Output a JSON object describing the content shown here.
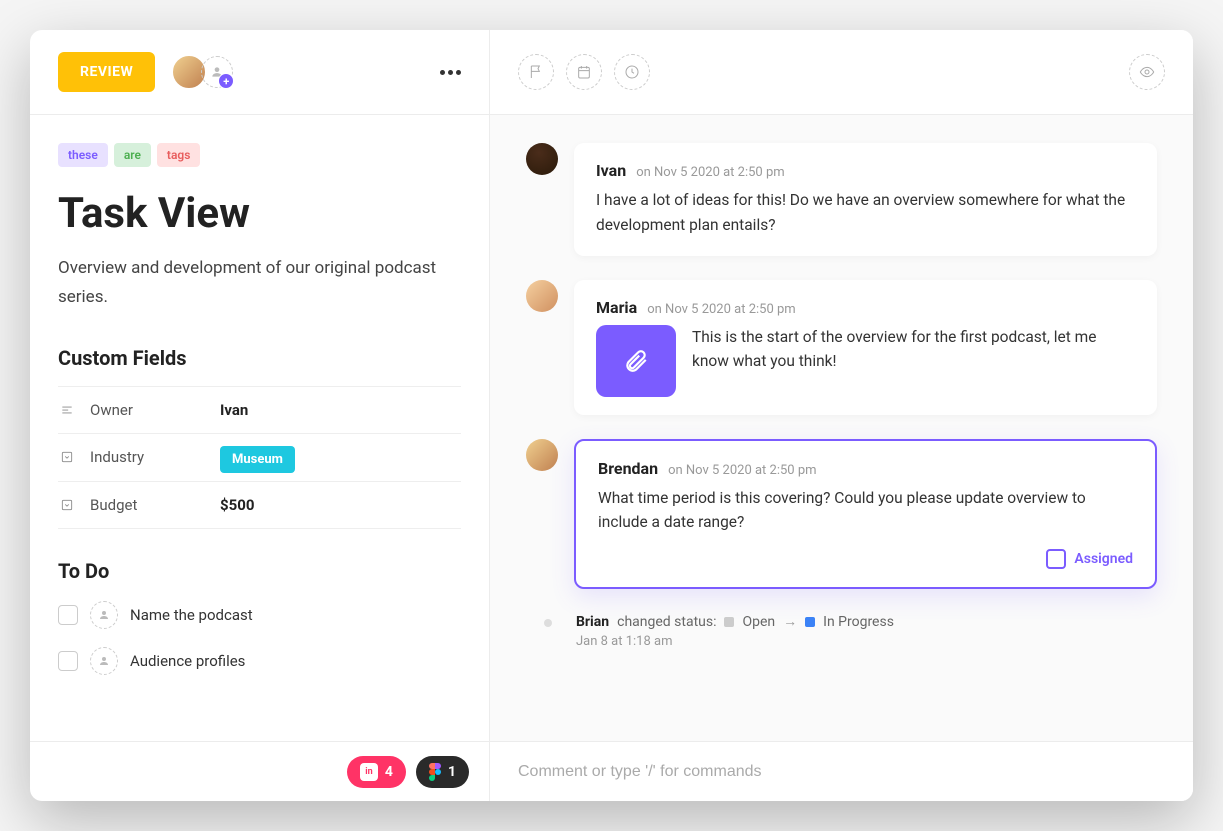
{
  "header": {
    "status_badge": "REVIEW"
  },
  "tags": [
    {
      "label": "these",
      "variant": "purple"
    },
    {
      "label": "are",
      "variant": "green"
    },
    {
      "label": "tags",
      "variant": "pink"
    }
  ],
  "page": {
    "title": "Task View",
    "description": "Overview and development of our original podcast series."
  },
  "custom_fields": {
    "section_title": "Custom Fields",
    "rows": [
      {
        "label": "Owner",
        "value": "Ivan",
        "type": "text"
      },
      {
        "label": "Industry",
        "value": "Museum",
        "type": "badge"
      },
      {
        "label": "Budget",
        "value": "$500",
        "type": "text"
      }
    ]
  },
  "todo": {
    "section_title": "To Do",
    "items": [
      {
        "text": "Name the podcast"
      },
      {
        "text": "Audience profiles"
      }
    ]
  },
  "footer_pills": {
    "invision_count": "4",
    "figma_count": "1"
  },
  "comments": [
    {
      "author": "Ivan",
      "time": "on Nov 5 2020 at 2:50 pm",
      "text": "I have a lot of ideas for this! Do we have an overview somewhere for what the development plan entails?",
      "avatar": "ivan"
    },
    {
      "author": "Maria",
      "time": "on Nov 5 2020 at 2:50 pm",
      "text": "This is the start of the overview for the first podcast, let me know what you think!",
      "avatar": "maria",
      "has_attachment": true
    },
    {
      "author": "Brendan",
      "time": "on Nov 5 2020 at 2:50 pm",
      "text": "What time period is this covering? Could you please update overview to include a date range?",
      "avatar": "brendan",
      "highlighted": true,
      "assigned_label": "Assigned"
    }
  ],
  "activity": {
    "actor": "Brian",
    "action": "changed status:",
    "from": "Open",
    "to": "In Progress",
    "time": "Jan 8 at 1:18 am"
  },
  "comment_input": {
    "placeholder": "Comment or type '/' for commands"
  }
}
